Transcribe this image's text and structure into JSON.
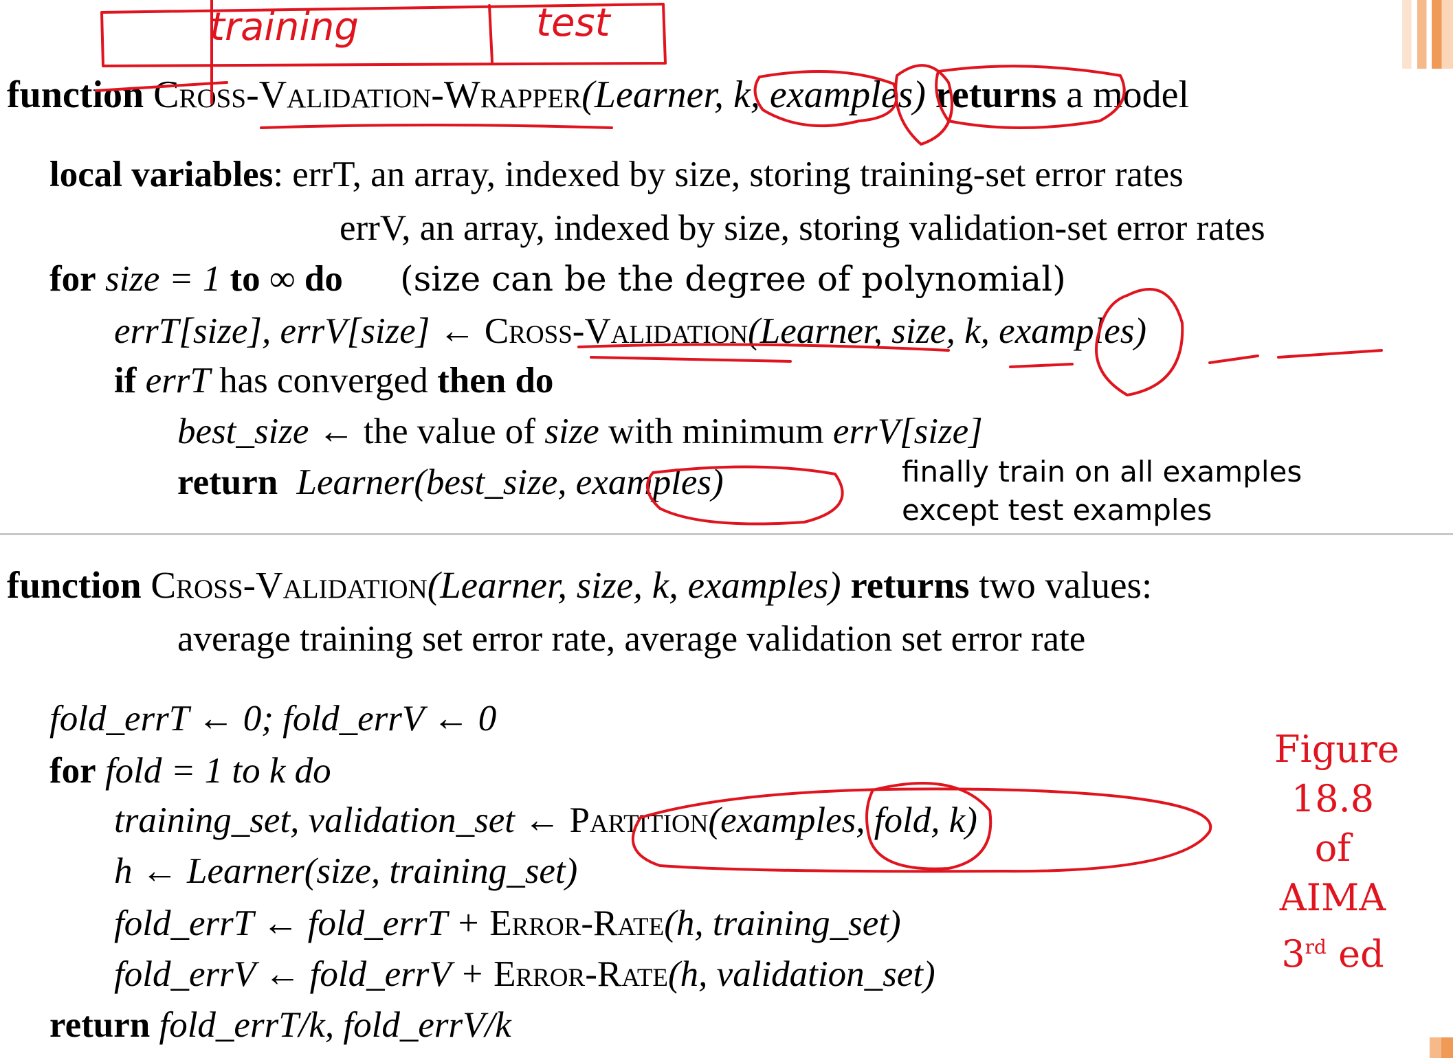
{
  "annotations": {
    "box_left": "training",
    "box_right": "test"
  },
  "wrapper": {
    "header": {
      "kw": "function",
      "name": "Cross-Validation-Wrapper",
      "args": "(Learner, k, examples)",
      "kw2": "returns",
      "tail": "a model"
    },
    "locals_kw": "local variables",
    "locals_1": ": errT, an array, indexed by size, storing training-set error rates",
    "locals_2": "errV, an array, indexed by size, storing validation-set error rates",
    "for_kw": "for",
    "for_body": "size = 1",
    "to_kw": "to",
    "inf": "∞",
    "do_kw": "do",
    "for_note": "(size can be the degree of polynomial)",
    "assign_lhs": "errT[size], errV[size] ←",
    "assign_fn": "Cross-Validation",
    "assign_args": "(Learner, size, k, examples)",
    "if_kw": "if",
    "if_cond": "errT",
    "if_mid": "has converged",
    "then_kw": "then do",
    "best_lhs": "best_size",
    "best_arrow": "←",
    "best_rhs1": "the value of",
    "best_var": "size",
    "best_rhs2": "with minimum",
    "best_var2": "errV[size]",
    "return_kw": "return",
    "return_expr": "Learner(best_size, examples)",
    "note_1": "finally train on all examples",
    "note_2": "except test examples"
  },
  "cv": {
    "kw": "function",
    "name": "Cross-Validation",
    "args": "(Learner, size, k, examples)",
    "kw2": "returns",
    "tail": "two values:",
    "tail_2": "average training set error rate, average validation set error rate",
    "init": "fold_errT ← 0; fold_errV ← 0",
    "for_kw": "for",
    "for_body": "fold = 1 to k do",
    "partition_lhs": "training_set, validation_set ←",
    "partition_fn": "Partition",
    "partition_args": "(examples, fold, k)",
    "h_line": "h ← Learner(size, training_set)",
    "errT_lhs": "fold_errT ← fold_errT +",
    "errT_fn": "Error-Rate",
    "errT_args": "(h, training_set)",
    "errV_lhs": "fold_errV ← fold_errV +",
    "errV_fn": "Error-Rate",
    "errV_args": "(h, validation_set)",
    "return_kw": "return",
    "return_expr": "fold_errT/k, fold_errV/k"
  },
  "figure_caption": {
    "l1": "Figure",
    "l2": "18.8 of",
    "l3": "AIMA",
    "l4_num": "3",
    "l4_sup": "rd",
    "l4_tail": " ed"
  },
  "colors": {
    "ink": "#e0141e",
    "accent": "#f0a060"
  }
}
